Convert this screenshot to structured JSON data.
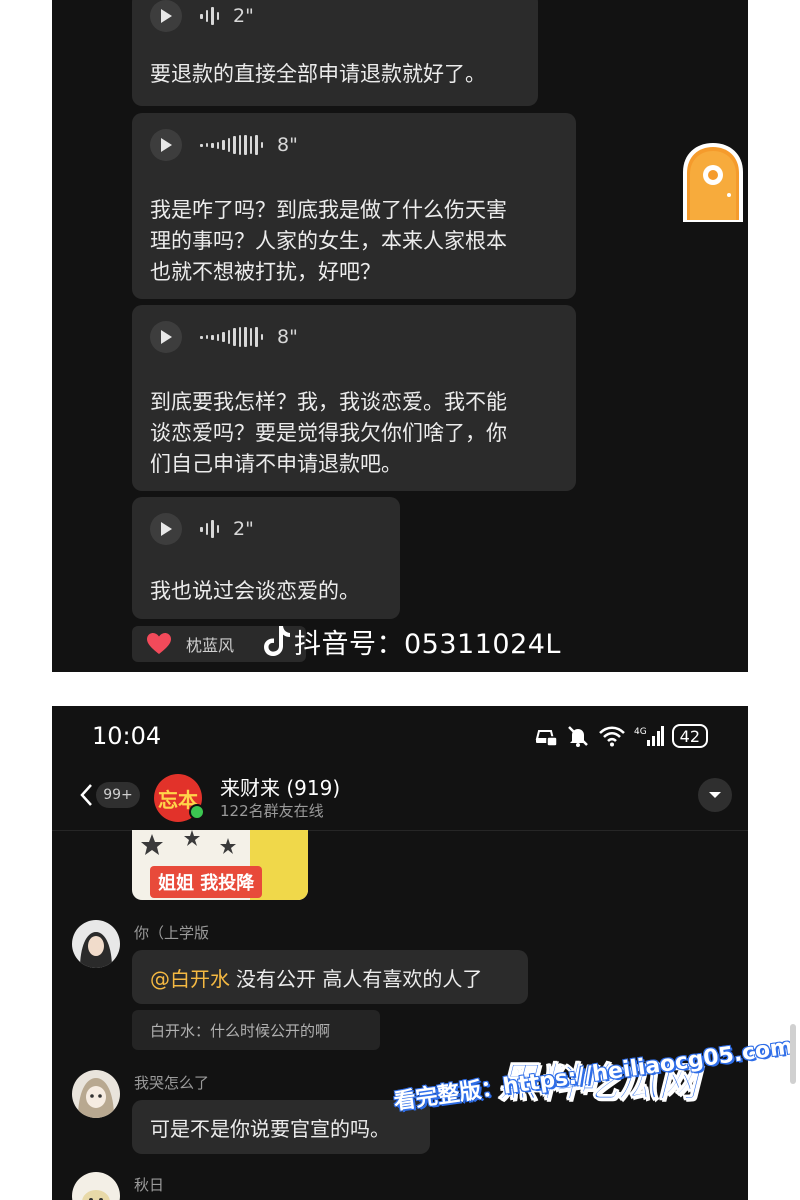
{
  "top_chat": {
    "voice_messages": [
      {
        "duration": "2\"",
        "transcript": "要退款的直接全部申请退款就好了。"
      },
      {
        "duration": "8\"",
        "transcript": "我是咋了吗？到底我是做了什么伤天害\n理的事吗？人家的女生，本来人家根本\n也就不想被打扰，好吧？"
      },
      {
        "duration": "8\"",
        "transcript": "到底要我怎样？我，我谈恋爱。我不能\n谈恋爱吗？要是觉得我欠你们啥了，你\n们自己申请不申请退款吧。"
      },
      {
        "duration": "2\"",
        "transcript": "我也说过会谈恋爱的。"
      }
    ],
    "reaction": {
      "user": "枕蓝风"
    },
    "douyin_id": "抖音号：05311024L"
  },
  "bottom_chat": {
    "status_bar": {
      "time": "10:04",
      "battery": "42"
    },
    "header": {
      "unread": "99+",
      "avatar_text": "忘本",
      "group_name": "来财来 (919)",
      "online": "122名群友在线"
    },
    "sticker_caption": "姐姐 我投降",
    "messages": [
      {
        "sender": "你（上学版",
        "mention": "@白开水",
        "text": "没有公开 高人有喜欢的人了",
        "quote": "白开水：什么时候公开的啊"
      },
      {
        "sender": "我哭怎么了",
        "text": "可是不是你说要官宣的吗。"
      },
      {
        "sender": "秋日"
      }
    ]
  },
  "watermark": {
    "title": "黑料吃瓜网",
    "url": "看完整版：https://heiliaocg05.com"
  },
  "colors": {
    "bubble": "#2b2b2b",
    "background": "#121212",
    "mention": "#f5b942",
    "watermark": "#2f6ee8",
    "online": "#3cc651"
  }
}
